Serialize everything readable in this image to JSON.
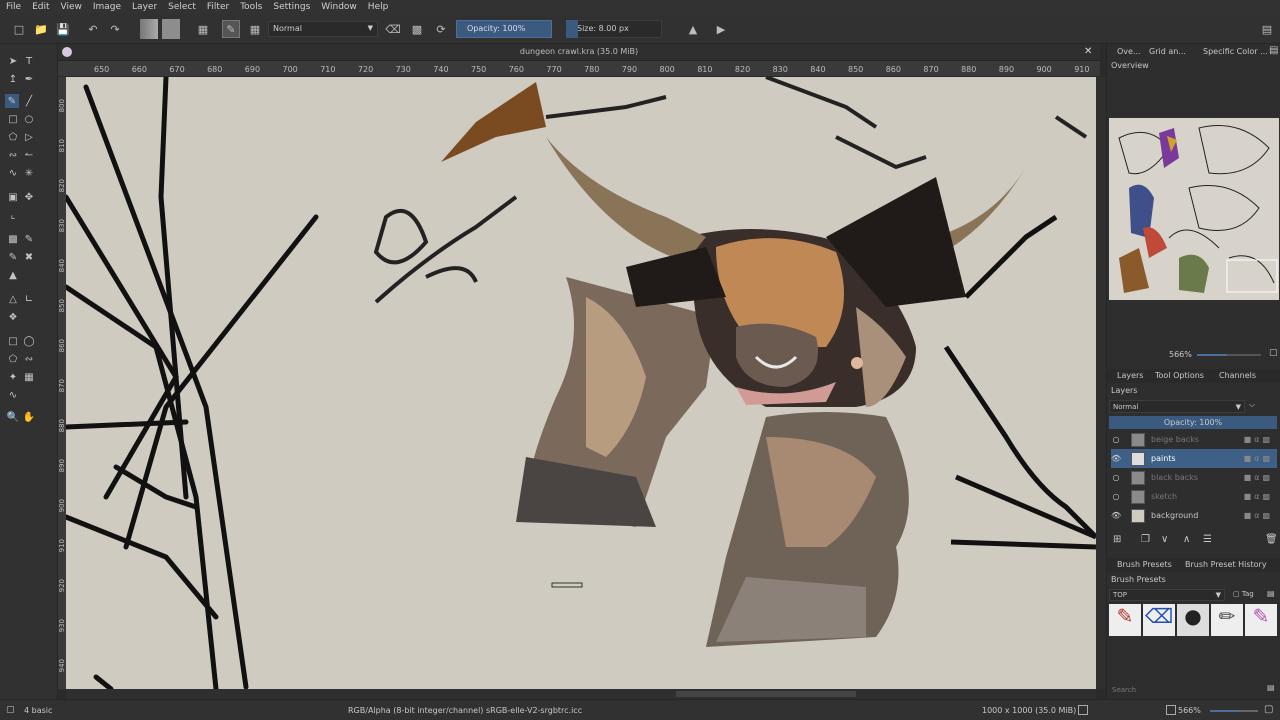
{
  "menubar": {
    "items": [
      "File",
      "Edit",
      "View",
      "Image",
      "Layer",
      "Select",
      "Filter",
      "Tools",
      "Settings",
      "Window",
      "Help"
    ]
  },
  "toolbar": {
    "blend_mode": "Normal",
    "opacity_label": "Opacity: 100%",
    "size_label": "Size: 8.00 px"
  },
  "document": {
    "title": "dungeon crawl.kra (35.0 MiB)"
  },
  "ruler": {
    "h_ticks": [
      "650",
      "660",
      "670",
      "680",
      "690",
      "700",
      "710",
      "720",
      "730",
      "740",
      "750",
      "760",
      "770",
      "780",
      "790",
      "800",
      "810",
      "820",
      "830",
      "840",
      "850",
      "860",
      "870",
      "880",
      "890",
      "900",
      "910"
    ],
    "v_ticks": [
      "800",
      "810",
      "820",
      "830",
      "840",
      "850",
      "860",
      "870",
      "880",
      "890",
      "900",
      "910",
      "920",
      "930",
      "940"
    ]
  },
  "dock": {
    "top_tabs": [
      "Ove...",
      "Grid an...",
      "Specific Color ..."
    ],
    "overview_title": "Overview",
    "zoom_value": "566%",
    "layer_tabs": [
      "Layers",
      "Tool Options",
      "Channels"
    ],
    "layers_title": "Layers",
    "layers_blend": "Normal",
    "layers_opacity": "Opacity: 100%",
    "layers": [
      {
        "name": "beige backs",
        "visible": false,
        "selected": false
      },
      {
        "name": "paints",
        "visible": true,
        "selected": true
      },
      {
        "name": "black backs",
        "visible": false,
        "selected": false
      },
      {
        "name": "sketch",
        "visible": false,
        "selected": false
      },
      {
        "name": "background",
        "visible": true,
        "selected": false
      }
    ],
    "brush_tabs": [
      "Brush Presets",
      "Brush Preset History"
    ],
    "brush_title": "Brush Presets",
    "brush_filter": "TOP",
    "brush_tag": "Tag",
    "search_placeholder": "Search"
  },
  "status": {
    "preset": "4 basic",
    "color_info": "RGB/Alpha (8-bit integer/channel)  sRGB-elle-V2-srgbtrc.icc",
    "image_info": "1000 x 1000 (35.0 MiB)",
    "zoom": "566%"
  },
  "colors": {
    "accent": "#3b5a80",
    "canvas": "#cfcbc1",
    "selected_layer": "#3e5f86"
  }
}
